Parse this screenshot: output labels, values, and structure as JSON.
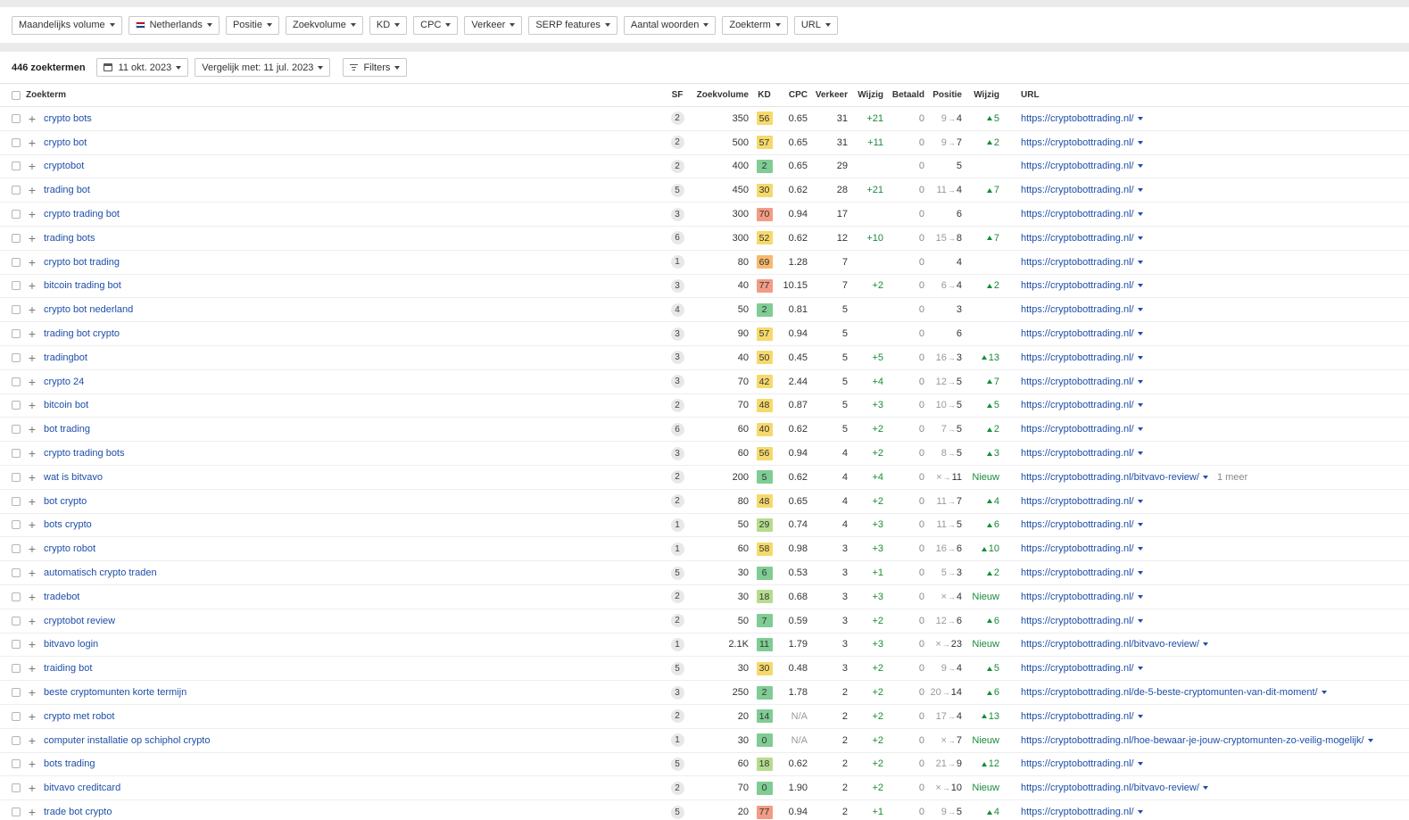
{
  "filters": {
    "monthly_volume": "Maandelijks volume",
    "country": "Netherlands",
    "position": "Positie",
    "search_volume": "Zoekvolume",
    "kd": "KD",
    "cpc": "CPC",
    "traffic": "Verkeer",
    "serp_features": "SERP features",
    "word_count": "Aantal woorden",
    "keyword": "Zoekterm",
    "url": "URL"
  },
  "summary": {
    "count": "446 zoektermen",
    "date": "11 okt. 2023",
    "compare": "Vergelijk met: 11 jul. 2023",
    "filters": "Filters"
  },
  "columns": {
    "keyword": "Zoekterm",
    "sf": "SF",
    "volume": "Zoekvolume",
    "kd": "KD",
    "cpc": "CPC",
    "traffic": "Verkeer",
    "traffic_change": "Wijzig",
    "paid": "Betaald",
    "position": "Positie",
    "position_change": "Wijzig",
    "url": "URL"
  },
  "colors": {
    "kd_green": "#7fcc94",
    "kd_lightgreen": "#b6dc8e",
    "kd_yellow": "#f6d96c",
    "kd_orange": "#f7b970",
    "kd_red": "#f39c85",
    "link": "#1e4ea8",
    "positive": "#1a8a3c"
  },
  "rows": [
    {
      "kw": "crypto bots",
      "sf": "2",
      "vol": "350",
      "kd": "56",
      "cpc": "0.65",
      "tr": "31",
      "trc": "+21",
      "paid": "0",
      "pos_from": "9",
      "pos_to": "4",
      "pos_change": "5",
      "url": "https://cryptobottrading.nl/",
      "more": ""
    },
    {
      "kw": "crypto bot",
      "sf": "2",
      "vol": "500",
      "kd": "57",
      "cpc": "0.65",
      "tr": "31",
      "trc": "+11",
      "paid": "0",
      "pos_from": "9",
      "pos_to": "7",
      "pos_change": "2",
      "url": "https://cryptobottrading.nl/",
      "more": ""
    },
    {
      "kw": "cryptobot",
      "sf": "2",
      "vol": "400",
      "kd": "2",
      "cpc": "0.65",
      "tr": "29",
      "trc": "",
      "paid": "0",
      "pos_from": "",
      "pos_to": "5",
      "pos_change": "",
      "url": "https://cryptobottrading.nl/",
      "more": ""
    },
    {
      "kw": "trading bot",
      "sf": "5",
      "vol": "450",
      "kd": "30",
      "cpc": "0.62",
      "tr": "28",
      "trc": "+21",
      "paid": "0",
      "pos_from": "11",
      "pos_to": "4",
      "pos_change": "7",
      "url": "https://cryptobottrading.nl/",
      "more": ""
    },
    {
      "kw": "crypto trading bot",
      "sf": "3",
      "vol": "300",
      "kd": "70",
      "cpc": "0.94",
      "tr": "17",
      "trc": "",
      "paid": "0",
      "pos_from": "",
      "pos_to": "6",
      "pos_change": "",
      "url": "https://cryptobottrading.nl/",
      "more": ""
    },
    {
      "kw": "trading bots",
      "sf": "6",
      "vol": "300",
      "kd": "52",
      "cpc": "0.62",
      "tr": "12",
      "trc": "+10",
      "paid": "0",
      "pos_from": "15",
      "pos_to": "8",
      "pos_change": "7",
      "url": "https://cryptobottrading.nl/",
      "more": ""
    },
    {
      "kw": "crypto bot trading",
      "sf": "1",
      "vol": "80",
      "kd": "69",
      "cpc": "1.28",
      "tr": "7",
      "trc": "",
      "paid": "0",
      "pos_from": "",
      "pos_to": "4",
      "pos_change": "",
      "url": "https://cryptobottrading.nl/",
      "more": ""
    },
    {
      "kw": "bitcoin trading bot",
      "sf": "3",
      "vol": "40",
      "kd": "77",
      "cpc": "10.15",
      "tr": "7",
      "trc": "+2",
      "paid": "0",
      "pos_from": "6",
      "pos_to": "4",
      "pos_change": "2",
      "url": "https://cryptobottrading.nl/",
      "more": ""
    },
    {
      "kw": "crypto bot nederland",
      "sf": "4",
      "vol": "50",
      "kd": "2",
      "cpc": "0.81",
      "tr": "5",
      "trc": "",
      "paid": "0",
      "pos_from": "",
      "pos_to": "3",
      "pos_change": "",
      "url": "https://cryptobottrading.nl/",
      "more": ""
    },
    {
      "kw": "trading bot crypto",
      "sf": "3",
      "vol": "90",
      "kd": "57",
      "cpc": "0.94",
      "tr": "5",
      "trc": "",
      "paid": "0",
      "pos_from": "",
      "pos_to": "6",
      "pos_change": "",
      "url": "https://cryptobottrading.nl/",
      "more": ""
    },
    {
      "kw": "tradingbot",
      "sf": "3",
      "vol": "40",
      "kd": "50",
      "cpc": "0.45",
      "tr": "5",
      "trc": "+5",
      "paid": "0",
      "pos_from": "16",
      "pos_to": "3",
      "pos_change": "13",
      "url": "https://cryptobottrading.nl/",
      "more": ""
    },
    {
      "kw": "crypto 24",
      "sf": "3",
      "vol": "70",
      "kd": "42",
      "cpc": "2.44",
      "tr": "5",
      "trc": "+4",
      "paid": "0",
      "pos_from": "12",
      "pos_to": "5",
      "pos_change": "7",
      "url": "https://cryptobottrading.nl/",
      "more": ""
    },
    {
      "kw": "bitcoin bot",
      "sf": "2",
      "vol": "70",
      "kd": "48",
      "cpc": "0.87",
      "tr": "5",
      "trc": "+3",
      "paid": "0",
      "pos_from": "10",
      "pos_to": "5",
      "pos_change": "5",
      "url": "https://cryptobottrading.nl/",
      "more": ""
    },
    {
      "kw": "bot trading",
      "sf": "6",
      "vol": "60",
      "kd": "40",
      "cpc": "0.62",
      "tr": "5",
      "trc": "+2",
      "paid": "0",
      "pos_from": "7",
      "pos_to": "5",
      "pos_change": "2",
      "url": "https://cryptobottrading.nl/",
      "more": ""
    },
    {
      "kw": "crypto trading bots",
      "sf": "3",
      "vol": "60",
      "kd": "56",
      "cpc": "0.94",
      "tr": "4",
      "trc": "+2",
      "paid": "0",
      "pos_from": "8",
      "pos_to": "5",
      "pos_change": "3",
      "url": "https://cryptobottrading.nl/",
      "more": ""
    },
    {
      "kw": "wat is bitvavo",
      "sf": "2",
      "vol": "200",
      "kd": "5",
      "cpc": "0.62",
      "tr": "4",
      "trc": "+4",
      "paid": "0",
      "pos_from": "×",
      "pos_to": "11",
      "pos_change": "Nieuw",
      "url": "https://cryptobottrading.nl/bitvavo-review/",
      "more": "1 meer"
    },
    {
      "kw": "bot crypto",
      "sf": "2",
      "vol": "80",
      "kd": "48",
      "cpc": "0.65",
      "tr": "4",
      "trc": "+2",
      "paid": "0",
      "pos_from": "11",
      "pos_to": "7",
      "pos_change": "4",
      "url": "https://cryptobottrading.nl/",
      "more": ""
    },
    {
      "kw": "bots crypto",
      "sf": "1",
      "vol": "50",
      "kd": "29",
      "cpc": "0.74",
      "tr": "4",
      "trc": "+3",
      "paid": "0",
      "pos_from": "11",
      "pos_to": "5",
      "pos_change": "6",
      "url": "https://cryptobottrading.nl/",
      "more": ""
    },
    {
      "kw": "crypto robot",
      "sf": "1",
      "vol": "60",
      "kd": "58",
      "cpc": "0.98",
      "tr": "3",
      "trc": "+3",
      "paid": "0",
      "pos_from": "16",
      "pos_to": "6",
      "pos_change": "10",
      "url": "https://cryptobottrading.nl/",
      "more": ""
    },
    {
      "kw": "automatisch crypto traden",
      "sf": "5",
      "vol": "30",
      "kd": "6",
      "cpc": "0.53",
      "tr": "3",
      "trc": "+1",
      "paid": "0",
      "pos_from": "5",
      "pos_to": "3",
      "pos_change": "2",
      "url": "https://cryptobottrading.nl/",
      "more": ""
    },
    {
      "kw": "tradebot",
      "sf": "2",
      "vol": "30",
      "kd": "18",
      "cpc": "0.68",
      "tr": "3",
      "trc": "+3",
      "paid": "0",
      "pos_from": "×",
      "pos_to": "4",
      "pos_change": "Nieuw",
      "url": "https://cryptobottrading.nl/",
      "more": ""
    },
    {
      "kw": "cryptobot review",
      "sf": "2",
      "vol": "50",
      "kd": "7",
      "cpc": "0.59",
      "tr": "3",
      "trc": "+2",
      "paid": "0",
      "pos_from": "12",
      "pos_to": "6",
      "pos_change": "6",
      "url": "https://cryptobottrading.nl/",
      "more": ""
    },
    {
      "kw": "bitvavo login",
      "sf": "1",
      "vol": "2.1K",
      "kd": "11",
      "cpc": "1.79",
      "tr": "3",
      "trc": "+3",
      "paid": "0",
      "pos_from": "×",
      "pos_to": "23",
      "pos_change": "Nieuw",
      "url": "https://cryptobottrading.nl/bitvavo-review/",
      "more": ""
    },
    {
      "kw": "traiding bot",
      "sf": "5",
      "vol": "30",
      "kd": "30",
      "cpc": "0.48",
      "tr": "3",
      "trc": "+2",
      "paid": "0",
      "pos_from": "9",
      "pos_to": "4",
      "pos_change": "5",
      "url": "https://cryptobottrading.nl/",
      "more": ""
    },
    {
      "kw": "beste cryptomunten korte termijn",
      "sf": "3",
      "vol": "250",
      "kd": "2",
      "cpc": "1.78",
      "tr": "2",
      "trc": "+2",
      "paid": "0",
      "pos_from": "20",
      "pos_to": "14",
      "pos_change": "6",
      "url": "https://cryptobottrading.nl/de-5-beste-cryptomunten-van-dit-moment/",
      "more": ""
    },
    {
      "kw": "crypto met robot",
      "sf": "2",
      "vol": "20",
      "kd": "14",
      "cpc": "N/A",
      "tr": "2",
      "trc": "+2",
      "paid": "0",
      "pos_from": "17",
      "pos_to": "4",
      "pos_change": "13",
      "url": "https://cryptobottrading.nl/",
      "more": ""
    },
    {
      "kw": "computer installatie op schiphol crypto",
      "sf": "1",
      "vol": "30",
      "kd": "0",
      "cpc": "N/A",
      "tr": "2",
      "trc": "+2",
      "paid": "0",
      "pos_from": "×",
      "pos_to": "7",
      "pos_change": "Nieuw",
      "url": "https://cryptobottrading.nl/hoe-bewaar-je-jouw-cryptomunten-zo-veilig-mogelijk/",
      "more": ""
    },
    {
      "kw": "bots trading",
      "sf": "5",
      "vol": "60",
      "kd": "18",
      "cpc": "0.62",
      "tr": "2",
      "trc": "+2",
      "paid": "0",
      "pos_from": "21",
      "pos_to": "9",
      "pos_change": "12",
      "url": "https://cryptobottrading.nl/",
      "more": ""
    },
    {
      "kw": "bitvavo creditcard",
      "sf": "2",
      "vol": "70",
      "kd": "0",
      "cpc": "1.90",
      "tr": "2",
      "trc": "+2",
      "paid": "0",
      "pos_from": "×",
      "pos_to": "10",
      "pos_change": "Nieuw",
      "url": "https://cryptobottrading.nl/bitvavo-review/",
      "more": ""
    },
    {
      "kw": "trade bot crypto",
      "sf": "5",
      "vol": "20",
      "kd": "77",
      "cpc": "0.94",
      "tr": "2",
      "trc": "+1",
      "paid": "0",
      "pos_from": "9",
      "pos_to": "5",
      "pos_change": "4",
      "url": "https://cryptobottrading.nl/",
      "more": ""
    }
  ]
}
